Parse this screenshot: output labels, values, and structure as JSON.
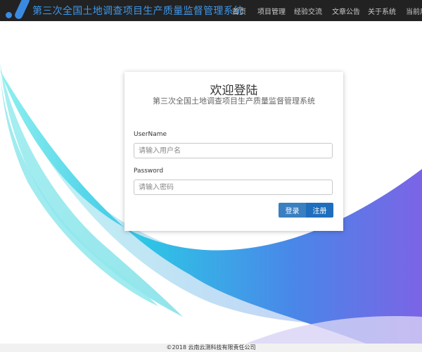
{
  "header": {
    "title": "第三次全国土地调查项目生产质量监督管理系统",
    "logo_icon": "app-logo-icon",
    "nav": [
      "首页",
      "项目管理",
      "经验交流",
      "文章公告",
      "关于系统",
      "当前用户"
    ]
  },
  "login": {
    "title": "欢迎登陆",
    "subtitle": "第三次全国土地调查项目生产质量监督管理系统",
    "username_label": "UserName",
    "username_placeholder": "请输入用户名",
    "password_label": "Password",
    "password_placeholder": "请输入密码",
    "login_button": "登录",
    "register_button": "注册"
  },
  "footer": {
    "copyright": "©2018 云南云测科技有限责任公司"
  },
  "colors": {
    "navbar": "#222222",
    "brand": "#3f96e8",
    "login_button": "#3a7fc0",
    "register_button": "#1f6ebd",
    "wave_cyan": "#8ee8ee",
    "wave_purple": "#7b6be6"
  }
}
